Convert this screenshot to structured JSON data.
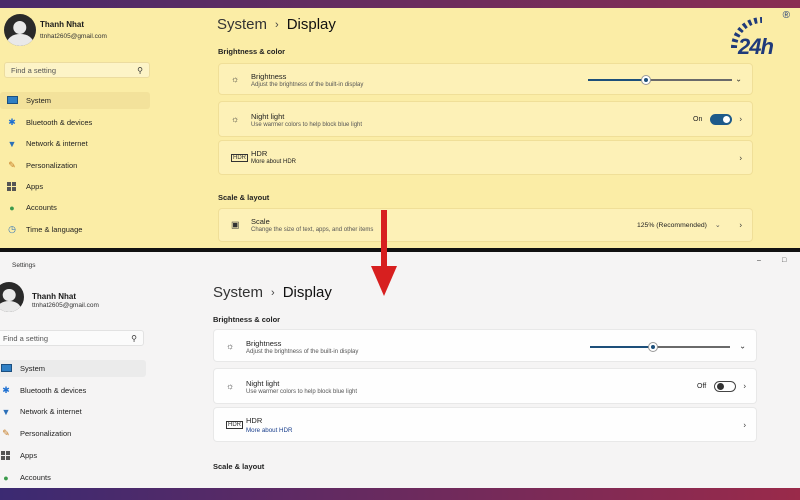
{
  "brand": {
    "logo_text": "24h",
    "registered": "®"
  },
  "colors": {
    "accent": "#1d4f7a",
    "night_tint": "#fbeda6",
    "arrow": "#d71f1f"
  },
  "top": {
    "user": {
      "name": "Thanh Nhat",
      "email": "ttnhat2605@gmail.com"
    },
    "search_placeholder": "Find a setting",
    "nav": [
      {
        "label": "System",
        "icon": "monitor-icon",
        "selected": true
      },
      {
        "label": "Bluetooth & devices",
        "icon": "bluetooth-icon"
      },
      {
        "label": "Network & internet",
        "icon": "wifi-icon"
      },
      {
        "label": "Personalization",
        "icon": "brush-icon"
      },
      {
        "label": "Apps",
        "icon": "apps-icon"
      },
      {
        "label": "Accounts",
        "icon": "person-icon"
      },
      {
        "label": "Time & language",
        "icon": "globe-clock-icon"
      }
    ],
    "breadcrumb": {
      "parent": "System",
      "separator": "›",
      "current": "Display"
    },
    "section_brightness": "Brightness & color",
    "brightness": {
      "title": "Brightness",
      "subtitle": "Adjust the brightness of the built-in display",
      "value": 0.4
    },
    "night_light": {
      "title": "Night light",
      "subtitle": "Use warmer colors to help block blue light",
      "state": "On"
    },
    "hdr": {
      "title": "HDR",
      "link": "More about HDR"
    },
    "section_scale": "Scale & layout",
    "scale": {
      "title": "Scale",
      "subtitle": "Change the size of text, apps, and other items",
      "value": "125% (Recommended)"
    }
  },
  "bottom": {
    "window_title": "Settings",
    "user": {
      "name": "Thanh Nhat",
      "email": "ttnhat2605@gmail.com"
    },
    "search_placeholder": "Find a setting",
    "nav": [
      {
        "label": "System",
        "icon": "monitor-icon",
        "selected": true
      },
      {
        "label": "Bluetooth & devices",
        "icon": "bluetooth-icon"
      },
      {
        "label": "Network & internet",
        "icon": "wifi-icon"
      },
      {
        "label": "Personalization",
        "icon": "brush-icon"
      },
      {
        "label": "Apps",
        "icon": "apps-icon"
      },
      {
        "label": "Accounts",
        "icon": "person-icon"
      }
    ],
    "breadcrumb": {
      "parent": "System",
      "separator": "›",
      "current": "Display"
    },
    "section_brightness": "Brightness & color",
    "brightness": {
      "title": "Brightness",
      "subtitle": "Adjust the brightness of the built-in display",
      "value": 0.45
    },
    "night_light": {
      "title": "Night light",
      "subtitle": "Use warmer colors to help block blue light",
      "state": "Off"
    },
    "hdr": {
      "title": "HDR",
      "link": "More about HDR"
    },
    "section_scale": "Scale & layout"
  }
}
